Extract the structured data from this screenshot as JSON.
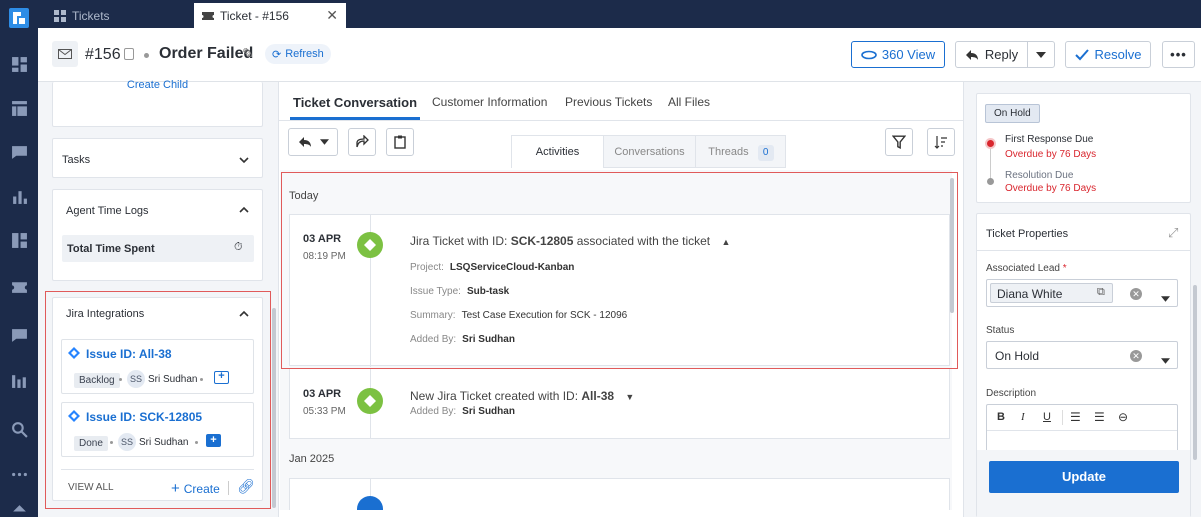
{
  "tabs": [
    {
      "label": "Tickets"
    },
    {
      "label": "Ticket - #156"
    }
  ],
  "header": {
    "ticket_number": "#156",
    "title": "Order Failed",
    "refresh_label": "Refresh",
    "view360_label": "360 View",
    "reply_label": "Reply",
    "resolve_label": "Resolve"
  },
  "left_panel": {
    "create_child_label": "Create Child",
    "tasks_label": "Tasks",
    "agent_time_logs_label": "Agent Time Logs",
    "total_time_spent_label": "Total Time Spent",
    "jira_title": "Jira Integrations",
    "issues": [
      {
        "id_label": "Issue ID: All-38",
        "status": "Backlog",
        "avatar": "SS",
        "assignee": "Sri Sudhan"
      },
      {
        "id_label": "Issue ID: SCK-12805",
        "status": "Done",
        "avatar": "SS",
        "assignee": "Sri Sudhan"
      }
    ],
    "view_all_label": "VIEW ALL",
    "create_label": "Create"
  },
  "center": {
    "tabs": [
      "Ticket Conversation",
      "Customer Information",
      "Previous Tickets",
      "All Files"
    ],
    "sub_tabs": {
      "activities": "Activities",
      "conversations": "Conversations",
      "threads": "Threads",
      "threads_count": "0"
    },
    "section_today": "Today",
    "section_jan": "Jan 2025",
    "activity1": {
      "date": "03 APR",
      "time": "08:19 PM",
      "headline_prefix": "Jira Ticket with ID: ",
      "headline_id": "SCK-12805",
      "headline_suffix": " associated with the ticket",
      "project_label": "Project:",
      "project_value": "LSQServiceCloud-Kanban",
      "issue_type_label": "Issue Type:",
      "issue_type_value": "Sub-task",
      "summary_label": "Summary:",
      "summary_value": "Test Case Execution for SCK - 12096",
      "added_by_label": "Added By:",
      "added_by_value": "Sri Sudhan"
    },
    "activity2": {
      "date": "03 APR",
      "time": "05:33 PM",
      "headline_prefix": "New Jira Ticket created with ID: ",
      "headline_id": "All-38",
      "added_by_label": "Added By:",
      "added_by_value": "Sri Sudhan"
    }
  },
  "right_panel": {
    "status_badge": "On Hold",
    "first_response_label": "First Response Due",
    "first_response_overdue": "Overdue by 76 Days",
    "resolution_label": "Resolution Due",
    "resolution_overdue": "Overdue by 76 Days",
    "properties_title": "Ticket Properties",
    "associated_lead_label": "Associated Lead",
    "required_mark": "*",
    "associated_lead_value": "Diana White",
    "status_label": "Status",
    "status_value": "On Hold",
    "description_label": "Description",
    "update_label": "Update"
  },
  "colors": {
    "accent_blue": "#1a6fd1",
    "nav_dark": "#1c2b4a",
    "overdue_red": "#d9262e",
    "jira_green": "#7cc142",
    "highlight_red": "#e05a5a"
  }
}
